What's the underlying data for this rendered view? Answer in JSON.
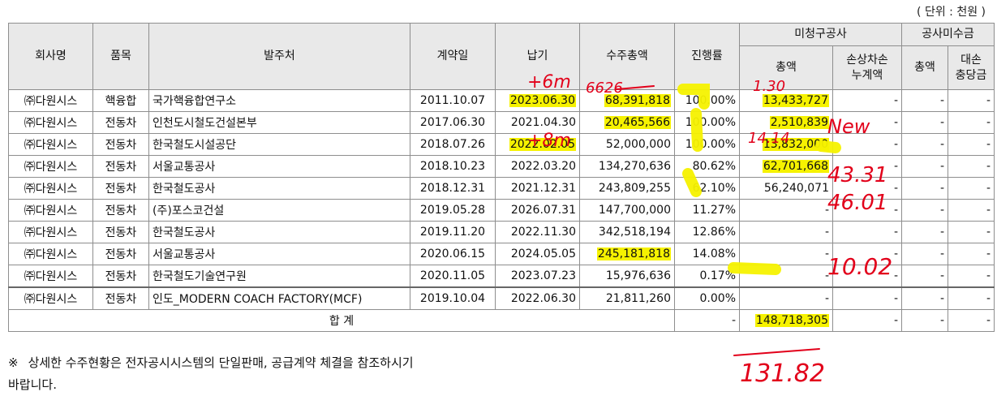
{
  "unit_label": "( 단위 : 천원 )",
  "headers": {
    "company": "회사명",
    "product": "품목",
    "client": "발주처",
    "contract_date": "계약일",
    "delivery": "납기",
    "total": "수주총액",
    "progress": "진행률",
    "unbilled_group": "미청구공사",
    "unbilled_total": "총액",
    "unbilled_loss": "손상차손\n누계액",
    "receivable_group": "공사미수금",
    "receivable_total": "총액",
    "receivable_allow": "대손\n충당금"
  },
  "rows": [
    {
      "company": "㈜다원시스",
      "product": "핵융합",
      "client": "국가핵융합연구소",
      "contract_date": "2011.10.07",
      "delivery": "2023.06.30",
      "total": "68,391,818",
      "progress": "100.00%",
      "unbilled_total": "13,433,727",
      "unbilled_loss": "-",
      "receivable_total": "-",
      "receivable_allow": "-"
    },
    {
      "company": "㈜다원시스",
      "product": "전동차",
      "client": "인천도시철도건설본부",
      "contract_date": "2017.06.30",
      "delivery": "2021.04.30",
      "total": "20,465,566",
      "progress": "100.00%",
      "unbilled_total": "2,510,839",
      "unbilled_loss": "-",
      "receivable_total": "-",
      "receivable_allow": "-"
    },
    {
      "company": "㈜다원시스",
      "product": "전동차",
      "client": "한국철도시설공단",
      "contract_date": "2018.07.26",
      "delivery": "2022.02.05",
      "total": "52,000,000",
      "progress": "100.00%",
      "unbilled_total": "13,832,000",
      "unbilled_loss": "-",
      "receivable_total": "-",
      "receivable_allow": "-"
    },
    {
      "company": "㈜다원시스",
      "product": "전동차",
      "client": "서울교통공사",
      "contract_date": "2018.10.23",
      "delivery": "2022.03.20",
      "total": "134,270,636",
      "progress": "80.62%",
      "unbilled_total": "62,701,668",
      "unbilled_loss": "-",
      "receivable_total": "-",
      "receivable_allow": "-"
    },
    {
      "company": "㈜다원시스",
      "product": "전동차",
      "client": "한국철도공사",
      "contract_date": "2018.12.31",
      "delivery": "2021.12.31",
      "total": "243,809,255",
      "progress": "62.10%",
      "unbilled_total": "56,240,071",
      "unbilled_loss": "-",
      "receivable_total": "-",
      "receivable_allow": "-"
    },
    {
      "company": "㈜다원시스",
      "product": "전동차",
      "client": "(주)포스코건설",
      "contract_date": "2019.05.28",
      "delivery": "2026.07.31",
      "total": "147,700,000",
      "progress": "11.27%",
      "unbilled_total": "-",
      "unbilled_loss": "-",
      "receivable_total": "-",
      "receivable_allow": "-"
    },
    {
      "company": "㈜다원시스",
      "product": "전동차",
      "client": "한국철도공사",
      "contract_date": "2019.11.20",
      "delivery": "2022.11.30",
      "total": "342,518,194",
      "progress": "12.86%",
      "unbilled_total": "-",
      "unbilled_loss": "-",
      "receivable_total": "-",
      "receivable_allow": "-"
    },
    {
      "company": "㈜다원시스",
      "product": "전동차",
      "client": "서울교통공사",
      "contract_date": "2020.06.15",
      "delivery": "2024.05.05",
      "total": "245,181,818",
      "progress": "14.08%",
      "unbilled_total": "-",
      "unbilled_loss": "-",
      "receivable_total": "-",
      "receivable_allow": "-"
    },
    {
      "company": "㈜다원시스",
      "product": "전동차",
      "client": "한국철도기술연구원",
      "contract_date": "2020.11.05",
      "delivery": "2023.07.23",
      "total": "15,976,636",
      "progress": "0.17%",
      "unbilled_total": "-",
      "unbilled_loss": "-",
      "receivable_total": "-",
      "receivable_allow": "-"
    },
    {
      "company": "㈜다원시스",
      "product": "전동차",
      "client": "인도_MODERN COACH FACTORY(MCF)",
      "contract_date": "2019.10.04",
      "delivery": "2022.06.30",
      "total": "21,811,260",
      "progress": "0.00%",
      "unbilled_total": "-",
      "unbilled_loss": "-",
      "receivable_total": "-",
      "receivable_allow": "-"
    }
  ],
  "total_row": {
    "label": "합 계",
    "progress": "-",
    "unbilled_total": "148,718,305",
    "unbilled_loss": "-",
    "receivable_total": "-",
    "receivable_allow": "-"
  },
  "footnote": {
    "mark": "※",
    "line1": "상세한 수주현황은 전자공시시스템의 단일판매, 공급계약 체결을 참조하시기",
    "line2": "바랍니다."
  },
  "annotations": {
    "a1": "+6m",
    "a2": "6626",
    "a3": "1.30",
    "a4": "New",
    "a5": "+8m",
    "a6": "14.14",
    "a7": "43.31",
    "a8": "46.01",
    "a9": "10.02",
    "a10": "131.82"
  },
  "colors": {
    "highlight": "#f6f200",
    "ink": "#e2001a",
    "header_bg": "#e9e9e9",
    "border": "#8e8e8e"
  },
  "highlighted_cells": [
    [
      0,
      "delivery"
    ],
    [
      0,
      "total"
    ],
    [
      0,
      "unbilled_total"
    ],
    [
      1,
      "total"
    ],
    [
      1,
      "unbilled_total"
    ],
    [
      2,
      "delivery"
    ],
    [
      2,
      "unbilled_total"
    ],
    [
      3,
      "unbilled_total"
    ],
    [
      7,
      "total"
    ]
  ]
}
